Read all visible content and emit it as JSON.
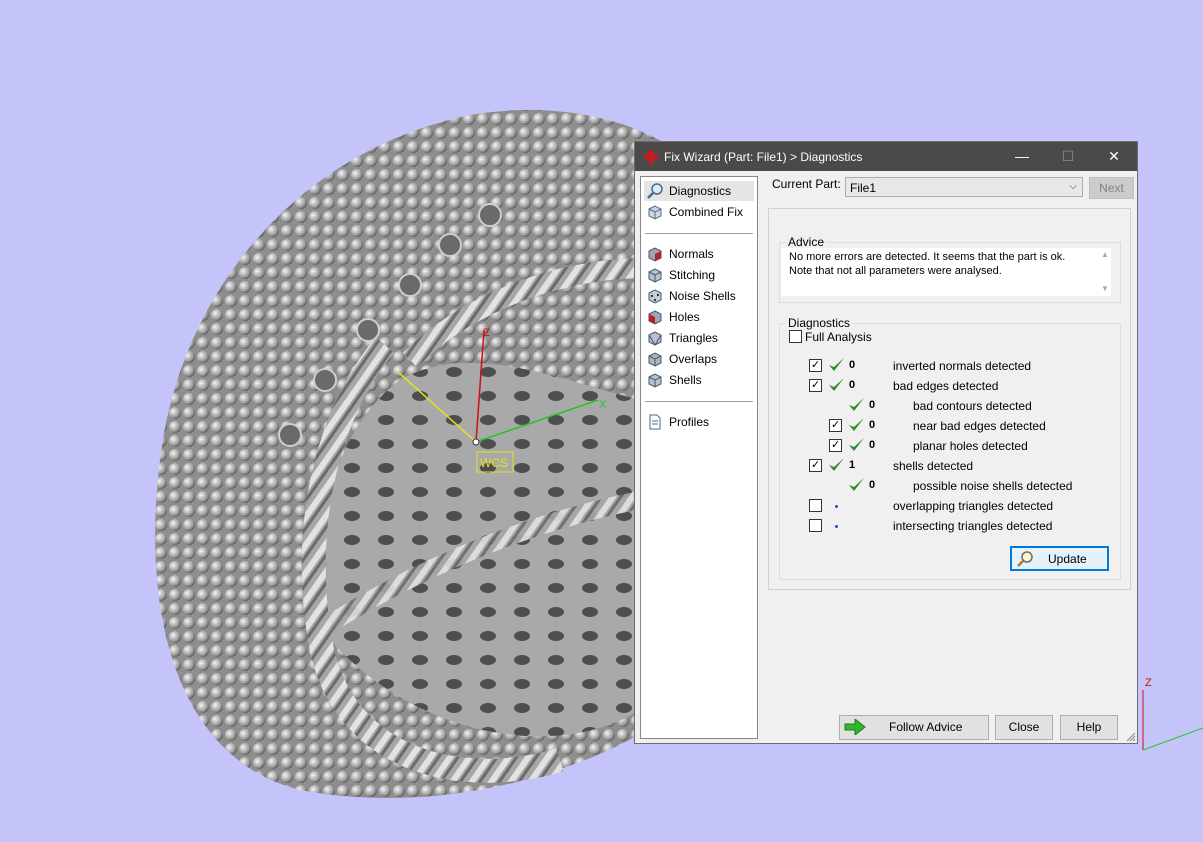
{
  "viewport": {
    "background": "#c4c4fb",
    "axes": {
      "z_label": "Z",
      "x_label": "X",
      "wcs_label": "WCS"
    },
    "corner_axes": {
      "z_label": "Z"
    }
  },
  "dialog": {
    "title": "Fix Wizard (Part: File1) > Diagnostics",
    "title_icon": "red-cross-icon",
    "window_buttons": {
      "minimize": "—",
      "maximize": "☐",
      "close": "✕"
    },
    "nav": {
      "top_items": [
        {
          "label": "Diagnostics",
          "icon": "magnifier-icon",
          "selected": true
        },
        {
          "label": "Combined Fix",
          "icon": "cube-icon"
        }
      ],
      "tool_items": [
        {
          "label": "Normals",
          "icon": "normals-cube-icon"
        },
        {
          "label": "Stitching",
          "icon": "stitching-cube-icon"
        },
        {
          "label": "Noise Shells",
          "icon": "noise-shells-cube-icon"
        },
        {
          "label": "Holes",
          "icon": "holes-cube-icon"
        },
        {
          "label": "Triangles",
          "icon": "triangles-cube-icon"
        },
        {
          "label": "Overlaps",
          "icon": "overlaps-cube-icon"
        },
        {
          "label": "Shells",
          "icon": "shells-cube-icon"
        }
      ],
      "bottom_items": [
        {
          "label": "Profiles",
          "icon": "document-icon"
        }
      ]
    },
    "current_part": {
      "label": "Current Part:",
      "value": "File1"
    },
    "next_button": "Next",
    "advice": {
      "title": "Advice",
      "line1": "No more errors are detected. It seems that the part is ok.",
      "line2": "Note that not all parameters were analysed."
    },
    "diagnostics": {
      "title": "Diagnostics",
      "full_analysis": "Full Analysis",
      "rows": [
        {
          "count": "0",
          "label": "inverted normals detected",
          "checked": true,
          "ok": true
        },
        {
          "count": "0",
          "label": "bad edges detected",
          "checked": true,
          "ok": true
        },
        {
          "count": "0",
          "label": "bad contours detected",
          "checked": false,
          "ok": true
        },
        {
          "count": "0",
          "label": "near bad edges detected",
          "checked": true,
          "ok": true
        },
        {
          "count": "0",
          "label": "planar holes detected",
          "checked": true,
          "ok": true
        },
        {
          "count": "1",
          "label": "shells detected",
          "checked": true,
          "ok": true
        },
        {
          "count": "0",
          "label": "possible noise shells detected",
          "checked": false,
          "ok": true
        },
        {
          "count": "",
          "label": "overlapping triangles detected",
          "checked": false,
          "ok": false
        },
        {
          "count": "",
          "label": "intersecting triangles detected",
          "checked": false,
          "ok": false
        }
      ],
      "update_button": "Update"
    },
    "footer": {
      "follow_advice": "Follow Advice",
      "close": "Close",
      "help": "Help"
    }
  }
}
